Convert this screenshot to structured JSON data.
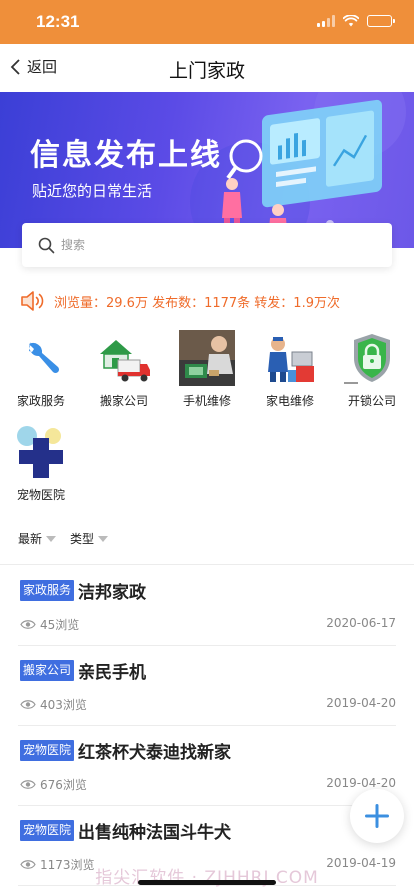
{
  "status_bar": {
    "time": "12:31"
  },
  "nav": {
    "back_label": "返回",
    "title": "上门家政"
  },
  "banner": {
    "headline": "信息发布上线",
    "subtitle": "贴近您的日常生活"
  },
  "search": {
    "placeholder": "搜索"
  },
  "stats": {
    "text": "浏览量：29.6万 发布数：1177条 转发：1.9万次"
  },
  "categories": [
    {
      "label": "家政服务",
      "icon": "wrench-icon"
    },
    {
      "label": "搬家公司",
      "icon": "moving-truck-icon"
    },
    {
      "label": "手机维修",
      "icon": "phone-repair-icon"
    },
    {
      "label": "家电维修",
      "icon": "appliance-repair-icon"
    },
    {
      "label": "开锁公司",
      "icon": "lock-shield-icon"
    },
    {
      "label": "宠物医院",
      "icon": "pet-hospital-icon"
    }
  ],
  "filters": {
    "latest": "最新",
    "type": "类型"
  },
  "listings": [
    {
      "tag": "家政服务",
      "title": "洁邦家政",
      "views": "45浏览",
      "date": "2020-06-17"
    },
    {
      "tag": "搬家公司",
      "title": "亲民手机",
      "views": "403浏览",
      "date": "2019-04-20"
    },
    {
      "tag": "宠物医院",
      "title": "红茶杯犬泰迪找新家",
      "views": "676浏览",
      "date": "2019-04-20"
    },
    {
      "tag": "宠物医院",
      "title": "出售纯种法国斗牛犬",
      "views": "1173浏览",
      "date": "2019-04-19"
    }
  ],
  "watermark": "指尖汇软件 · ZJHHRJ.COM",
  "colors": {
    "status_bar": "#ef8f3a",
    "accent": "#ef6b2a",
    "tag": "#3f6ee0",
    "fab_plus": "#3b8fe0"
  }
}
